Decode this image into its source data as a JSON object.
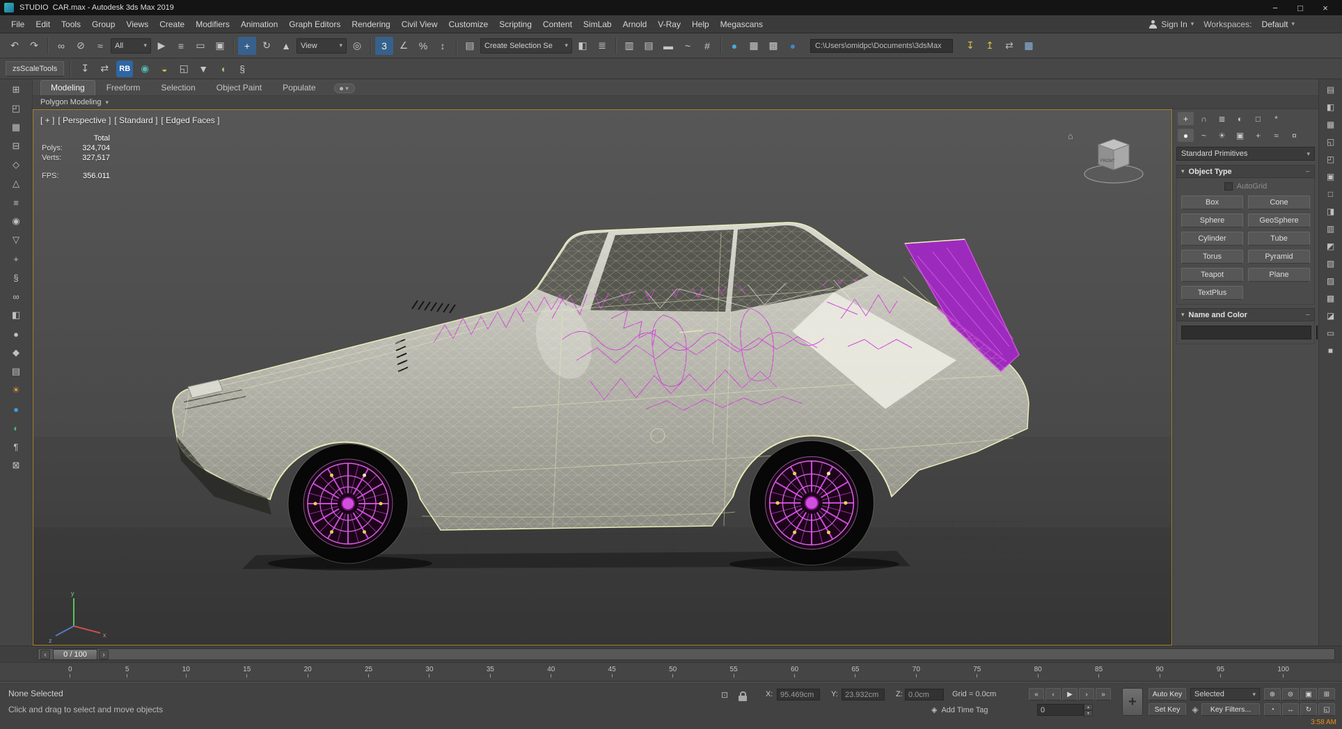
{
  "window": {
    "title": "STUDIO  CAR.max - Autodesk 3ds Max 2019",
    "minimize": "−",
    "maximize": "□",
    "close": "×"
  },
  "menu": {
    "items": [
      "File",
      "Edit",
      "Tools",
      "Group",
      "Views",
      "Create",
      "Modifiers",
      "Animation",
      "Graph Editors",
      "Rendering",
      "Civil View",
      "Customize",
      "Scripting",
      "Content",
      "SimLab",
      "Arnold",
      "V-Ray",
      "Help",
      "Megascans"
    ],
    "sign_in_label": "Sign In",
    "workspaces_label": "Workspaces:",
    "workspace_value": "Default"
  },
  "toolbar1": {
    "history": [
      {
        "name": "undo-icon",
        "glyph": "↶"
      },
      {
        "name": "redo-icon",
        "glyph": "↷"
      }
    ],
    "links": [
      {
        "name": "select-and-link-icon",
        "glyph": "∞"
      },
      {
        "name": "unlink-selection-icon",
        "glyph": "⊘"
      },
      {
        "name": "bind-to-space-warp-icon",
        "glyph": "≈"
      }
    ],
    "filter_value": "All",
    "selection": [
      {
        "name": "select-object-icon",
        "glyph": "▶"
      },
      {
        "name": "select-by-name-icon",
        "glyph": "≡"
      },
      {
        "name": "rectangular-selection-region-icon",
        "glyph": "▭"
      },
      {
        "name": "window-crossing-icon",
        "glyph": "▣"
      }
    ],
    "transforms": [
      {
        "name": "select-and-move-icon",
        "glyph": "+",
        "active": true
      },
      {
        "name": "select-and-rotate-icon",
        "glyph": "↻"
      },
      {
        "name": "select-and-scale-icon",
        "glyph": "▲"
      }
    ],
    "view_value": "View",
    "pivot": [
      {
        "name": "use-pivot-point-center-icon",
        "glyph": "◎"
      }
    ],
    "snaps": [
      {
        "name": "snaps-toggle-icon",
        "glyph": "3",
        "active": true
      },
      {
        "name": "angle-snap-icon",
        "glyph": "∠"
      },
      {
        "name": "percent-snap-icon",
        "glyph": "%"
      },
      {
        "name": "spinner-snap-icon",
        "glyph": "↕"
      }
    ],
    "named_sel": [
      {
        "name": "edit-named-selection-sets-icon",
        "glyph": "▤"
      }
    ],
    "selection_set_value": "Create Selection Se",
    "mirror_align": [
      {
        "name": "mirror-icon",
        "glyph": "◧"
      },
      {
        "name": "align-icon",
        "glyph": "≣"
      }
    ],
    "managers": [
      {
        "name": "toggle-scene-explorer-icon",
        "glyph": "▥"
      },
      {
        "name": "toggle-layer-explorer-icon",
        "glyph": "▤"
      },
      {
        "name": "toggle-ribbon-icon",
        "glyph": "▬"
      },
      {
        "name": "curve-editor-icon",
        "glyph": "~"
      },
      {
        "name": "schematic-view-icon",
        "glyph": "#"
      }
    ],
    "render": [
      {
        "name": "material-editor-icon",
        "glyph": "●",
        "color": "#4fa8d8"
      },
      {
        "name": "render-setup-icon",
        "glyph": "▦",
        "color": "#cccccc"
      },
      {
        "name": "rendered-frame-window-icon",
        "glyph": "▩"
      },
      {
        "name": "render-production-icon",
        "glyph": "●",
        "color": "#3f86c8"
      }
    ],
    "path_value": "C:\\Users\\omidpc\\Documents\\3dsMax",
    "extras": [
      {
        "name": "import-tool-icon",
        "glyph": "↧",
        "color": "#d8c04a"
      },
      {
        "name": "export-tool-icon",
        "glyph": "↥",
        "color": "#d8c04a"
      },
      {
        "name": "asset-tracking-icon",
        "glyph": "⇄",
        "color": "#bbbbbb"
      },
      {
        "name": "help-tool-icon",
        "glyph": "▦",
        "color": "#8fb8e0"
      }
    ]
  },
  "toolbar2": {
    "zsscale_label": "zsScaleTools",
    "icons_a": [
      {
        "name": "save-tool-icon",
        "glyph": "↧"
      },
      {
        "name": "transform-tools-icon",
        "glyph": "⇄"
      }
    ],
    "rb_label": "RB",
    "icons_b": [
      {
        "name": "relink-bitmaps-icon",
        "glyph": "◉",
        "color": "#54b8b0"
      },
      {
        "name": "sini-tools-icon",
        "glyph": "◒",
        "color": "#c8b84a"
      },
      {
        "name": "pivot-tool-icon",
        "glyph": "◱"
      },
      {
        "name": "collapse-tool-icon",
        "glyph": "▼"
      },
      {
        "name": "render-teapot-icon",
        "glyph": "◖",
        "color": "#9ac27a"
      },
      {
        "name": "script-listener-icon",
        "glyph": "§"
      }
    ]
  },
  "ribbon": {
    "tabs": [
      {
        "label": "Modeling",
        "active": true
      },
      {
        "label": "Freeform"
      },
      {
        "label": "Selection"
      },
      {
        "label": "Object Paint"
      },
      {
        "label": "Populate"
      }
    ],
    "section_label": "Polygon Modeling"
  },
  "viewport": {
    "label_segments": [
      {
        "name": "viewport-general-menu",
        "text": "[ + ]"
      },
      {
        "name": "viewport-pov-menu",
        "text": "[ Perspective ]"
      },
      {
        "name": "viewport-shading-menu",
        "text": "[ Standard ]"
      },
      {
        "name": "viewport-style-menu",
        "text": "[ Edged Faces ]"
      }
    ],
    "stats": {
      "total_label": "Total",
      "polys_label": "Polys:",
      "polys_value": "324,704",
      "verts_label": "Verts:",
      "verts_value": "327,517",
      "fps_label": "FPS:",
      "fps_value": "356.011"
    }
  },
  "command_panel": {
    "tabs": [
      {
        "name": "create-tab",
        "glyph": "+",
        "active": true
      },
      {
        "name": "modify-tab",
        "glyph": "∩"
      },
      {
        "name": "hierarchy-tab",
        "glyph": "≣"
      },
      {
        "name": "motion-tab",
        "glyph": "◐"
      },
      {
        "name": "display-tab",
        "glyph": "□"
      },
      {
        "name": "utilities-tab",
        "glyph": "*"
      }
    ],
    "categories": [
      {
        "name": "geometry-category",
        "glyph": "●",
        "active": true
      },
      {
        "name": "shapes-category",
        "glyph": "~"
      },
      {
        "name": "lights-category",
        "glyph": "☀"
      },
      {
        "name": "cameras-category",
        "glyph": "▣"
      },
      {
        "name": "helpers-category",
        "glyph": "+"
      },
      {
        "name": "space-warps-category",
        "glyph": "≈"
      },
      {
        "name": "systems-category",
        "glyph": "¤"
      }
    ],
    "dropdown_value": "Standard Primitives",
    "object_type_title": "Object Type",
    "autogrid_label": "AutoGrid",
    "object_buttons": [
      "Box",
      "Cone",
      "Sphere",
      "GeoSphere",
      "Cylinder",
      "Tube",
      "Torus",
      "Pyramid",
      "Teapot",
      "Plane",
      "TextPlus"
    ],
    "name_color_title": "Name and Color",
    "swatch_color": "#e23bc0"
  },
  "left_strip": [
    {
      "name": "left-tool-icon-1",
      "glyph": "⊞"
    },
    {
      "name": "left-tool-icon-2",
      "glyph": "◰"
    },
    {
      "name": "left-tool-icon-3",
      "glyph": "▦"
    },
    {
      "name": "left-tool-icon-4",
      "glyph": "⊟"
    },
    {
      "name": "left-tool-icon-5",
      "glyph": "◇"
    },
    {
      "name": "left-tool-icon-6",
      "glyph": "△"
    },
    {
      "name": "left-tool-icon-7",
      "glyph": "≡"
    },
    {
      "name": "left-tool-icon-8",
      "glyph": "◉"
    },
    {
      "name": "left-tool-icon-9",
      "glyph": "▽"
    },
    {
      "name": "left-tool-icon-10",
      "glyph": "+"
    },
    {
      "name": "left-tool-icon-11",
      "glyph": "§"
    },
    {
      "name": "left-tool-icon-12",
      "glyph": "∞"
    },
    {
      "name": "left-tool-icon-13",
      "glyph": "◧"
    },
    {
      "name": "left-tool-icon-14",
      "glyph": "●"
    },
    {
      "name": "left-tool-icon-15",
      "glyph": "◆"
    },
    {
      "name": "left-tool-icon-16",
      "glyph": "▤"
    },
    {
      "name": "left-tool-icon-17",
      "glyph": "☀",
      "color": "#e8a33d"
    },
    {
      "name": "left-tool-icon-18",
      "glyph": "●",
      "color": "#3f9fd8"
    },
    {
      "name": "left-tool-icon-19",
      "glyph": "◐",
      "color": "#49b87a"
    },
    {
      "name": "left-tool-icon-20",
      "glyph": "¶"
    },
    {
      "name": "left-tool-icon-21",
      "glyph": "⊠"
    }
  ],
  "right_strip": [
    {
      "name": "side-tool-icon-1",
      "glyph": "▤"
    },
    {
      "name": "side-tool-icon-2",
      "glyph": "◧"
    },
    {
      "name": "side-tool-icon-3",
      "glyph": "▦"
    },
    {
      "name": "side-tool-icon-4",
      "glyph": "◱"
    },
    {
      "name": "side-tool-icon-5",
      "glyph": "◰"
    },
    {
      "name": "side-tool-icon-6",
      "glyph": "▣"
    },
    {
      "name": "side-tool-icon-7",
      "glyph": "□"
    },
    {
      "name": "side-tool-icon-8",
      "glyph": "◨"
    },
    {
      "name": "side-tool-icon-9",
      "glyph": "▥"
    },
    {
      "name": "side-tool-icon-10",
      "glyph": "◩"
    },
    {
      "name": "side-tool-icon-11",
      "glyph": "▧"
    },
    {
      "name": "side-tool-icon-12",
      "glyph": "▨"
    },
    {
      "name": "side-tool-icon-13",
      "glyph": "▩"
    },
    {
      "name": "side-tool-icon-14",
      "glyph": "◪"
    },
    {
      "name": "side-tool-icon-15",
      "glyph": "▭"
    },
    {
      "name": "side-tool-icon-16",
      "glyph": "■"
    }
  ],
  "timeline": {
    "prev_label": "‹",
    "frame_label": "0 / 100",
    "next_label": "›"
  },
  "ruler": {
    "ticks": [
      "0",
      "5",
      "10",
      "15",
      "20",
      "25",
      "30",
      "35",
      "40",
      "45",
      "50",
      "55",
      "60",
      "65",
      "70",
      "75",
      "80",
      "85",
      "90",
      "95",
      "100"
    ]
  },
  "status": {
    "selection_text": "None Selected",
    "prompt_text": "Click and drag to select and move objects",
    "gizmo_icon_glyph": "⊡",
    "x_label": "X:",
    "x_value": "95.469cm",
    "y_label": "Y:",
    "y_value": "23.932cm",
    "z_label": "Z:",
    "z_value": "0.0cm",
    "grid_text": "Grid = 0.0cm",
    "time_tag_icon_glyph": "◈",
    "time_tag_text": "Add Time Tag",
    "playback": [
      {
        "name": "go-to-start-button",
        "glyph": "«"
      },
      {
        "name": "previous-frame-button",
        "glyph": "‹"
      },
      {
        "name": "play-button",
        "glyph": "▶"
      },
      {
        "name": "next-frame-button",
        "glyph": "›"
      },
      {
        "name": "go-to-end-button",
        "glyph": "»"
      }
    ],
    "frame_value": "0",
    "set_keys_glyph": "+",
    "auto_key_label": "Auto Key",
    "set_key_label": "Set Key",
    "selected_value": "Selected",
    "key_filters_icon_glyph": "◈",
    "key_filters_label": "Key Filters...",
    "nav": [
      {
        "name": "zoom-icon",
        "glyph": "⊕"
      },
      {
        "name": "zoom-all-icon",
        "glyph": "⊜"
      },
      {
        "name": "zoom-extents-icon",
        "glyph": "▣"
      },
      {
        "name": "zoom-region-icon",
        "glyph": "⊞"
      },
      {
        "name": "fov-icon",
        "glyph": "◔"
      },
      {
        "name": "pan-icon",
        "glyph": "↔"
      },
      {
        "name": "orbit-icon",
        "glyph": "↻"
      },
      {
        "name": "maximize-viewport-icon",
        "glyph": "◱"
      }
    ],
    "corner_time": "3:58 AM"
  }
}
